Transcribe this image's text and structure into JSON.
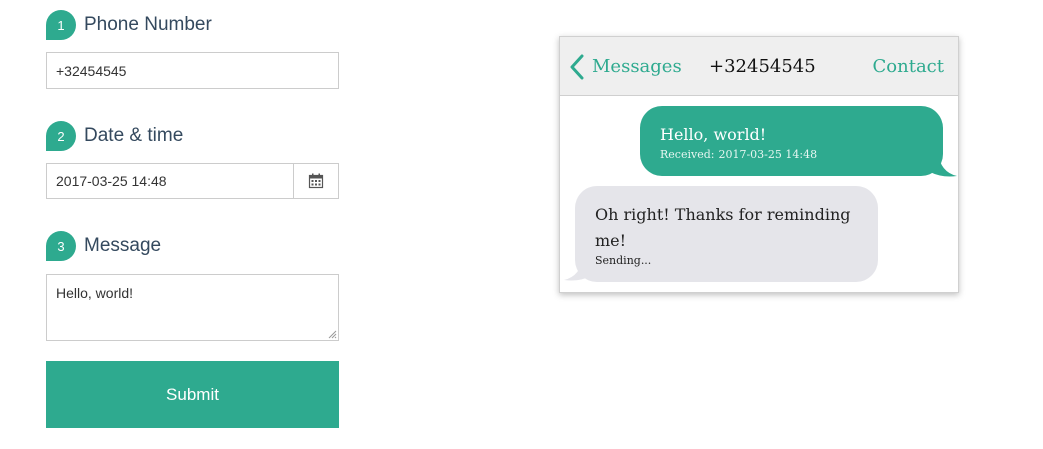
{
  "form": {
    "phone": {
      "step": "1",
      "label": "Phone Number",
      "value": "+32454545"
    },
    "datetime": {
      "step": "2",
      "label": "Date & time",
      "value": "2017-03-25 14:48",
      "button_icon": "calendar-icon"
    },
    "message": {
      "step": "3",
      "label": "Message",
      "value": "Hello, world!"
    },
    "submit_label": "Submit"
  },
  "preview": {
    "back_label": "Messages",
    "phone_number": "+32454545",
    "contact_label": "Contact",
    "messages": [
      {
        "text": "Hello, world!",
        "status": "Received:",
        "time": "2017-03-25 14:48",
        "direction": "outgoing"
      },
      {
        "text": "Oh right! Thanks for reminding me!",
        "status": "Sending...",
        "direction": "incoming"
      }
    ]
  },
  "colors": {
    "accent": "#2eaa8f",
    "incoming_bubble": "#e5e5ea",
    "label_text": "#34495e"
  }
}
